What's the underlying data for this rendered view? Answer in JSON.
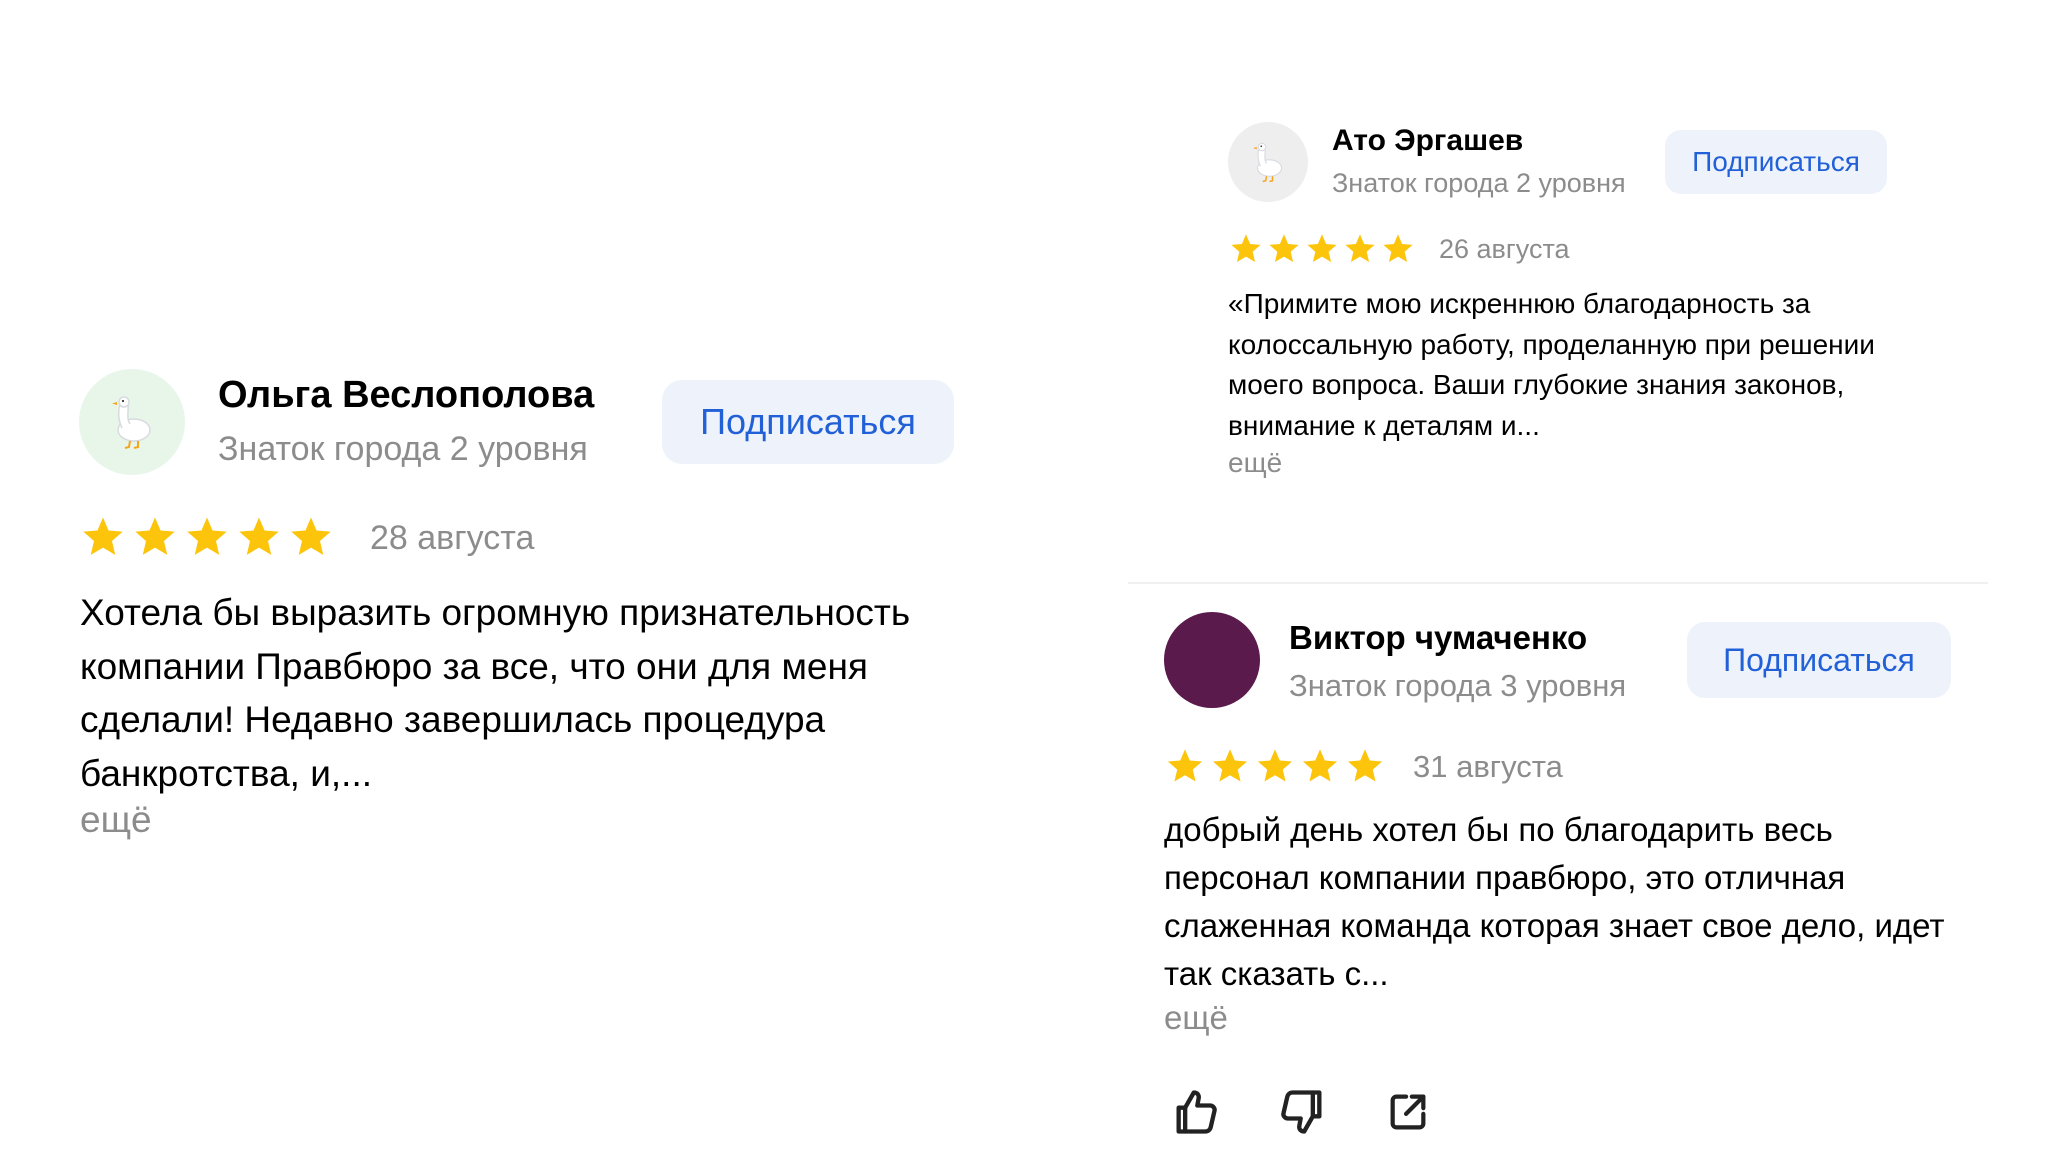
{
  "colors": {
    "accent": "#2160d6",
    "subscribe_bg": "#eef3fb",
    "star": "#fcc40a",
    "muted": "#8c8c8c",
    "avatar_goose_bg": "#e8f6ea",
    "avatar_purple": "#5a1a4c"
  },
  "reviews": [
    {
      "author": "Ольга Веслополова",
      "badge": "Знаток города 2 уровня",
      "subscribe_label": "Подписаться",
      "rating": 5,
      "date": "28 августа",
      "text": "Хотела бы выразить огромную признательность компании Правбюро за все, что они для меня сделали! Недавно завершилась процедура банкротства, и,...",
      "more_label": "ещё",
      "avatar_icon": "goose-icon"
    },
    {
      "author": "Ато Эргашев",
      "badge": "Знаток города 2 уровня",
      "subscribe_label": "Подписаться",
      "rating": 5,
      "date": "26 августа",
      "text": "«Примите мою искреннюю благодарность за колоссальную работу, проделанную при решении моего вопроса. Ваши глубокие знания законов, внимание к деталям и...",
      "more_label": "ещё",
      "avatar_icon": "goose-icon"
    },
    {
      "author": "Виктор чумаченко",
      "badge": "Знаток города 3 уровня",
      "subscribe_label": "Подписаться",
      "rating": 5,
      "date": "31 августа",
      "text": "добрый день хотел бы по благодарить весь персонал компании правбюро, это отличная слаженная команда которая знает свое дело, идет так сказать с...",
      "more_label": "ещё",
      "avatar_icon": "purple-circle-avatar"
    }
  ],
  "actions": [
    {
      "icon": "thumbs-up-icon"
    },
    {
      "icon": "thumbs-down-icon"
    },
    {
      "icon": "share-icon"
    }
  ]
}
